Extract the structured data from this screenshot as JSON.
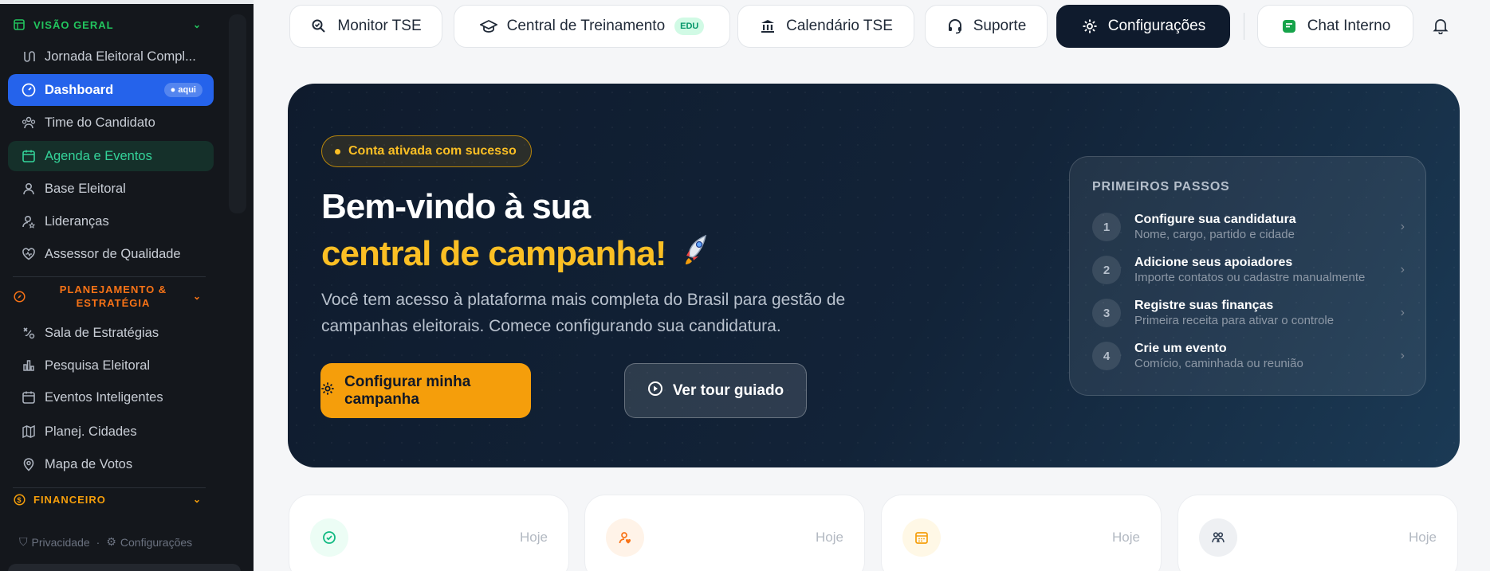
{
  "sidebar": {
    "sections": [
      {
        "label": "VISÃO GERAL",
        "color": "#22c55e"
      },
      {
        "label": "PLANEJAMENTO & ESTRATÉGIA",
        "label_line1": "PLANEJAMENTO &",
        "label_line2": "ESTRATÉGIA",
        "color": "#f97316"
      },
      {
        "label": "FINANCEIRO",
        "color": "#f59e0b"
      }
    ],
    "items": [
      {
        "label": "Jornada Eleitoral Compl...",
        "icon": "route-icon"
      },
      {
        "label": "Dashboard",
        "icon": "gauge-icon",
        "badge": "aqui",
        "active": true
      },
      {
        "label": "Time do Candidato",
        "icon": "team-icon"
      },
      {
        "label": "Agenda e Eventos",
        "icon": "calendar-icon",
        "highlight": true
      },
      {
        "label": "Base Eleitoral",
        "icon": "user-icon"
      },
      {
        "label": "Lideranças",
        "icon": "user-star-icon"
      },
      {
        "label": "Assessor de Qualidade",
        "icon": "heart-icon"
      },
      {
        "label": "Sala de Estratégias",
        "icon": "strategy-icon"
      },
      {
        "label": "Pesquisa Eleitoral",
        "icon": "bar-chart-icon"
      },
      {
        "label": "Eventos Inteligentes",
        "icon": "calendar-icon"
      },
      {
        "label": "Planej. Cidades",
        "icon": "map-icon"
      },
      {
        "label": "Mapa de Votos",
        "icon": "map-pin-icon"
      }
    ],
    "footer": {
      "privacy": "Privacidade",
      "settings": "Configurações",
      "separator": "·"
    }
  },
  "topbar": {
    "tabs": [
      {
        "label": "Monitor TSE",
        "icon": "monitor-tse-icon"
      },
      {
        "label": "Central de Treinamento",
        "icon": "graduation-cap-icon",
        "badge": "EDU"
      },
      {
        "label": "Calendário TSE",
        "icon": "bank-icon"
      },
      {
        "label": "Suporte",
        "icon": "headset-icon"
      },
      {
        "label": "Configurações",
        "icon": "gear-icon",
        "active": true
      },
      {
        "label": "Chat Interno",
        "icon": "chat-icon"
      }
    ],
    "bell_icon": "bell-icon"
  },
  "hero": {
    "status_pill": "Conta ativada com sucesso",
    "title_line1": "Bem-vindo à sua",
    "title_line2": "central de campanha!",
    "rocket": "🚀",
    "description": "Você tem acesso à plataforma mais completa do Brasil para gestão de campanhas eleitorais. Comece configurando sua candidatura.",
    "primary_button": "Configurar minha campanha",
    "secondary_button": "Ver tour guiado",
    "steps_title": "PRIMEIROS PASSOS",
    "steps": [
      {
        "num": "1",
        "title": "Configure sua candidatura",
        "subtitle": "Nome, cargo, partido e cidade"
      },
      {
        "num": "2",
        "title": "Adicione seus apoiadores",
        "subtitle": "Importe contatos ou cadastre manualmente"
      },
      {
        "num": "3",
        "title": "Registre suas finanças",
        "subtitle": "Primeira receita para ativar o controle"
      },
      {
        "num": "4",
        "title": "Crie um evento",
        "subtitle": "Comício, caminhada ou reunião"
      }
    ]
  },
  "stats": [
    {
      "period": "Hoje",
      "icon": "check-circle-icon",
      "color": "#10b981"
    },
    {
      "period": "Hoje",
      "icon": "user-heart-icon",
      "color": "#f97316"
    },
    {
      "period": "Hoje",
      "icon": "calendar-icon",
      "color": "#f59e0b"
    },
    {
      "period": "Hoje",
      "icon": "people-icon",
      "color": "#334155"
    }
  ]
}
